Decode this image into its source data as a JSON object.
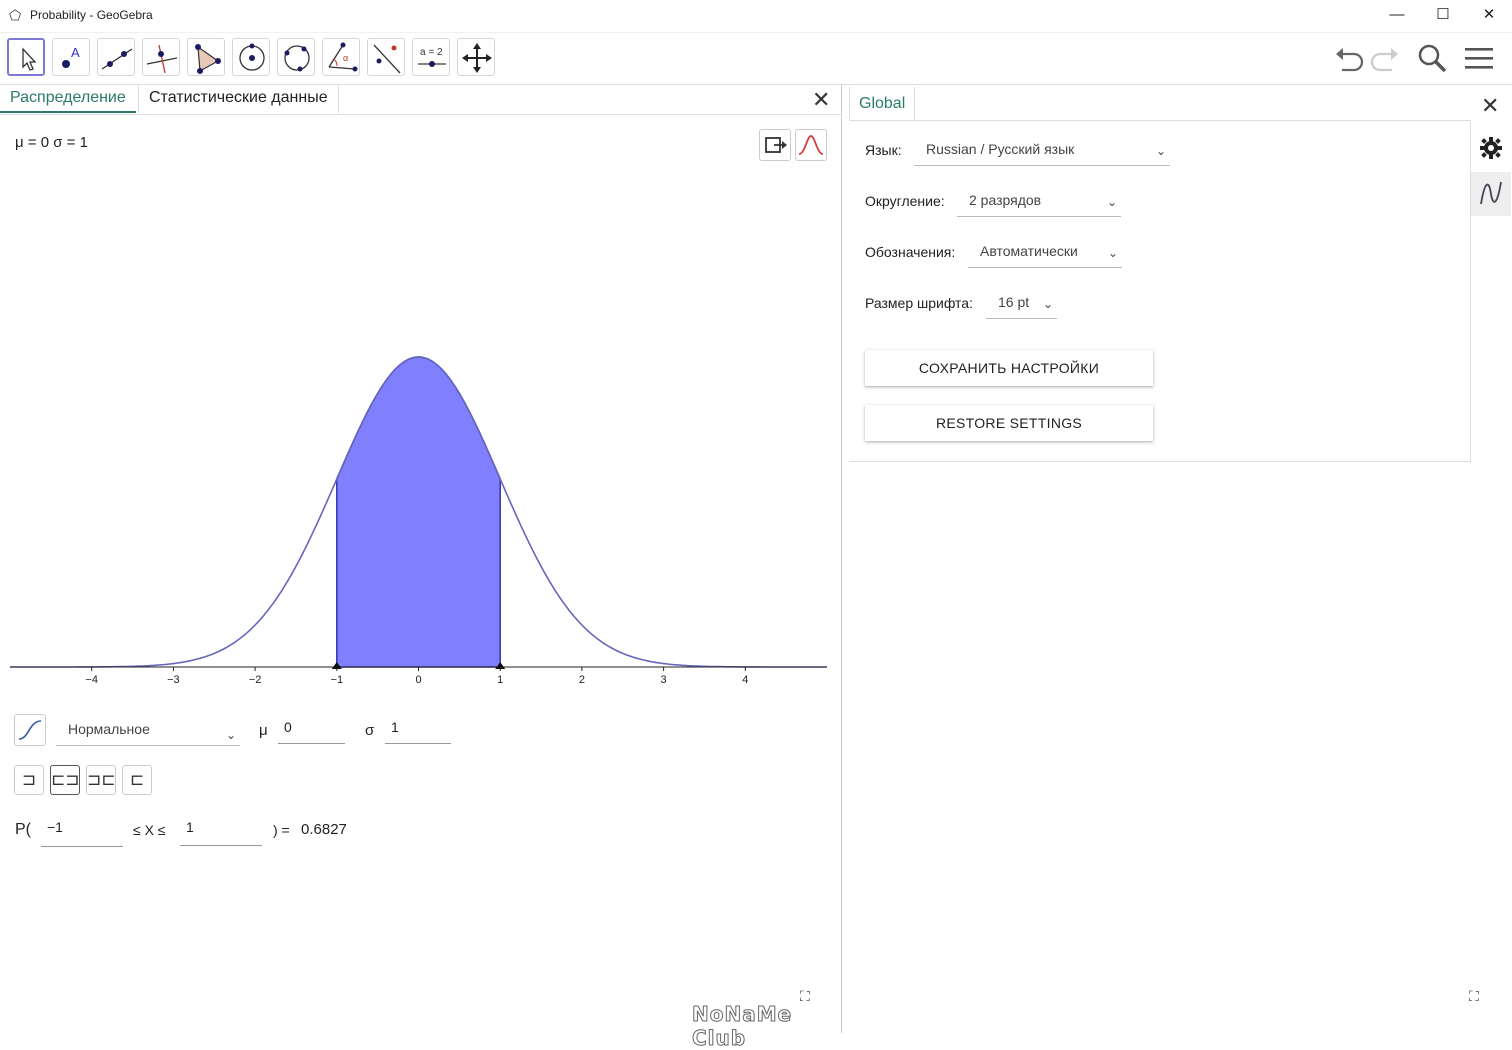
{
  "window": {
    "title": "Probability - GeoGebra",
    "minimize": "—",
    "maximize": "☐",
    "close": "✕"
  },
  "toolbar": {
    "tools": [
      "move-tool",
      "point-tool",
      "line-tool",
      "perpendicular-tool",
      "polygon-tool",
      "circle-center-tool",
      "circle-three-points-tool",
      "angle-tool",
      "reflect-tool",
      "slider-tool",
      "move-view-tool"
    ],
    "slider_label": "a = 2"
  },
  "left": {
    "tab_distribution": "Распределение",
    "tab_statistics": "Статистические данные",
    "params": "μ = 0  σ = 1",
    "dist_select": "Нормальное",
    "mu_label": "μ",
    "mu_value": "0",
    "sigma_label": "σ",
    "sigma_value": "1",
    "p_open": "P(",
    "lower": "−1",
    "between": "≤ X ≤",
    "upper": "1",
    "p_close": ") =",
    "result": "0.6827",
    "watermark": "NoNaMe Club"
  },
  "chart_data": {
    "type": "area",
    "title": "",
    "xlabel": "",
    "ylabel": "",
    "curve": "normal-pdf",
    "mu": 0,
    "sigma": 1,
    "shaded_interval": [
      -1,
      1
    ],
    "xlim": [
      -5,
      5
    ],
    "x_ticks": [
      -4,
      -3,
      -2,
      -1,
      0,
      1,
      2,
      3,
      4
    ],
    "x_tick_labels": [
      "−4",
      "−3",
      "−2",
      "−1",
      "0",
      "1",
      "2",
      "3",
      "4"
    ],
    "colors": {
      "fill": "#8080ff",
      "stroke": "#3333aa",
      "curve": "#6666bb"
    }
  },
  "right": {
    "tab_global": "Global",
    "language_label": "Язык:",
    "language_value": "Russian / Русский язык",
    "rounding_label": "Округление:",
    "rounding_value": "2 разрядов",
    "labeling_label": "Обозначения:",
    "labeling_value": "Автоматически",
    "fontsize_label": "Размер шрифта:",
    "fontsize_value": "16 pt",
    "save_button": "СОХРАНИТЬ НАСТРОЙКИ",
    "restore_button": "RESTORE SETTINGS"
  }
}
